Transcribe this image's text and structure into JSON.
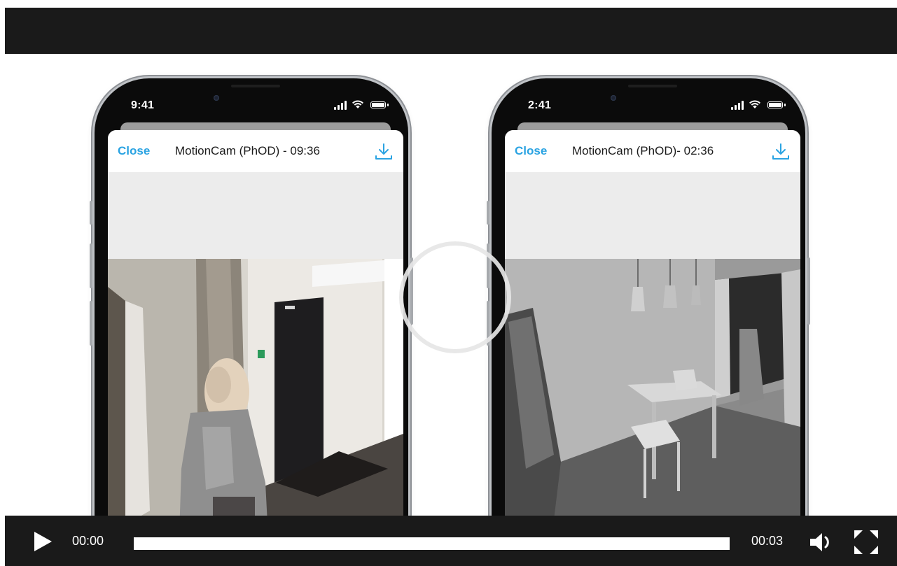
{
  "phones": [
    {
      "status_time": "9:41",
      "close_label": "Close",
      "title": "MotionCam (PhOD) - 09:36"
    },
    {
      "status_time": "2:41",
      "close_label": "Close",
      "title": "MotionCam (PhOD)- 02:36"
    }
  ],
  "player": {
    "current_time": "00:00",
    "duration": "00:03",
    "progress_fraction": 0
  },
  "colors": {
    "accent": "#2aa3e2",
    "bar_background": "#1a1a1a"
  }
}
